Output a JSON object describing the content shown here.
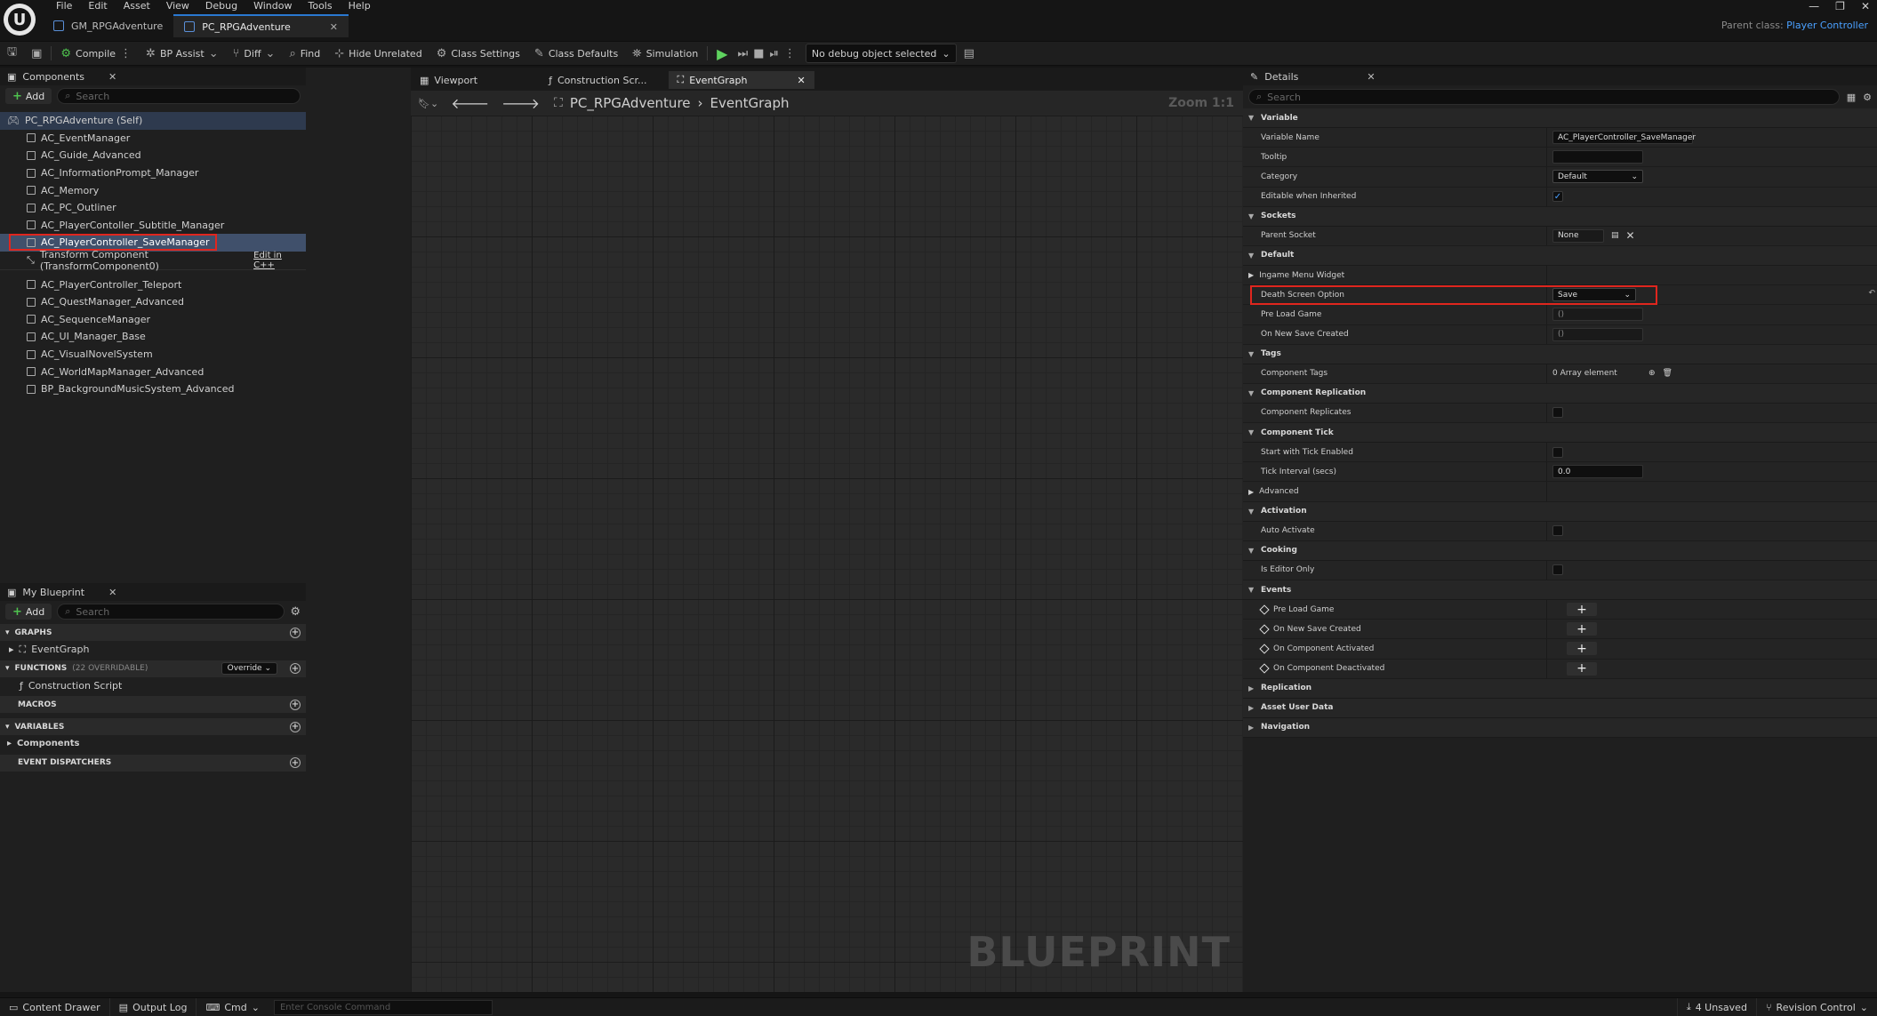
{
  "menu": [
    "File",
    "Edit",
    "Asset",
    "View",
    "Debug",
    "Window",
    "Tools",
    "Help"
  ],
  "doc_tabs": [
    {
      "label": "GM_RPGAdventure"
    },
    {
      "label": "PC_RPGAdventure"
    }
  ],
  "parent_class": {
    "label": "Parent class:",
    "value": "Player Controller"
  },
  "toolbar": {
    "compile": "Compile",
    "bp_assist": "BP Assist",
    "diff": "Diff",
    "find": "Find",
    "hide_unrelated": "Hide Unrelated",
    "class_settings": "Class Settings",
    "class_defaults": "Class Defaults",
    "simulation": "Simulation",
    "debug_select": "No debug object selected"
  },
  "components": {
    "tab": "Components",
    "add": "Add",
    "search_placeholder": "Search",
    "root": "PC_RPGAdventure (Self)",
    "items": [
      "AC_EventManager",
      "AC_Guide_Advanced",
      "AC_InformationPrompt_Manager",
      "AC_Memory",
      "AC_PC_Outliner",
      "AC_PlayerContoller_Subtitle_Manager",
      "AC_PlayerController_SaveManager",
      "Transform Component (TransformComponent0)",
      "AC_PlayerController_Teleport",
      "AC_QuestManager_Advanced",
      "AC_SequenceManager",
      "AC_UI_Manager_Base",
      "AC_VisualNovelSystem",
      "AC_WorldMapManager_Advanced",
      "BP_BackgroundMusicSystem_Advanced"
    ],
    "edit_cpp": "Edit in C++"
  },
  "my_blueprint": {
    "tab": "My Blueprint",
    "add": "Add",
    "search_placeholder": "Search",
    "graphs": "GRAPHS",
    "event_graph": "EventGraph",
    "functions": "FUNCTIONS",
    "functions_sub": "(22 OVERRIDABLE)",
    "override": "Override",
    "construction_script": "Construction Script",
    "macros": "MACROS",
    "variables": "VARIABLES",
    "components": "Components",
    "event_dispatchers": "EVENT DISPATCHERS"
  },
  "graph": {
    "tabs": [
      "Viewport",
      "Construction Scr...",
      "EventGraph"
    ],
    "breadcrumb_root": "PC_RPGAdventure",
    "breadcrumb_leaf": "EventGraph",
    "zoom": "Zoom 1:1",
    "watermark": "BLUEPRINT"
  },
  "details": {
    "tab": "Details",
    "search_placeholder": "Search",
    "variable": "Variable",
    "variable_name_label": "Variable Name",
    "variable_name": "AC_PlayerController_SaveManager",
    "tooltip": "Tooltip",
    "category": "Category",
    "category_value": "Default",
    "editable": "Editable when Inherited",
    "sockets": "Sockets",
    "parent_socket": "Parent Socket",
    "parent_socket_value": "None",
    "default": "Default",
    "ingame_menu": "Ingame Menu Widget",
    "death_screen": "Death Screen Option",
    "death_screen_value": "Save",
    "pre_load_game": "Pre Load Game",
    "pre_load_value": "()",
    "on_new_save": "On New Save Created",
    "on_new_save_value": "()",
    "tags": "Tags",
    "component_tags": "Component Tags",
    "component_tags_value": "0 Array element",
    "component_replication": "Component Replication",
    "component_replicates": "Component Replicates",
    "component_tick": "Component Tick",
    "start_tick": "Start with Tick Enabled",
    "tick_interval": "Tick Interval (secs)",
    "tick_interval_value": "0.0",
    "advanced": "Advanced",
    "activation": "Activation",
    "auto_activate": "Auto Activate",
    "cooking": "Cooking",
    "is_editor_only": "Is Editor Only",
    "events": "Events",
    "event_items": [
      "Pre Load Game",
      "On New Save Created",
      "On Component Activated",
      "On Component Deactivated"
    ],
    "replication": "Replication",
    "asset_user_data": "Asset User Data",
    "navigation": "Navigation"
  },
  "statusbar": {
    "content_drawer": "Content Drawer",
    "output_log": "Output Log",
    "cmd": "Cmd",
    "console_placeholder": "Enter Console Command",
    "unsaved": "4 Unsaved",
    "revision_control": "Revision Control"
  },
  "colors": {
    "accent": "#2a78d1",
    "highlight": "#e0261e",
    "selection": "#40506b"
  }
}
